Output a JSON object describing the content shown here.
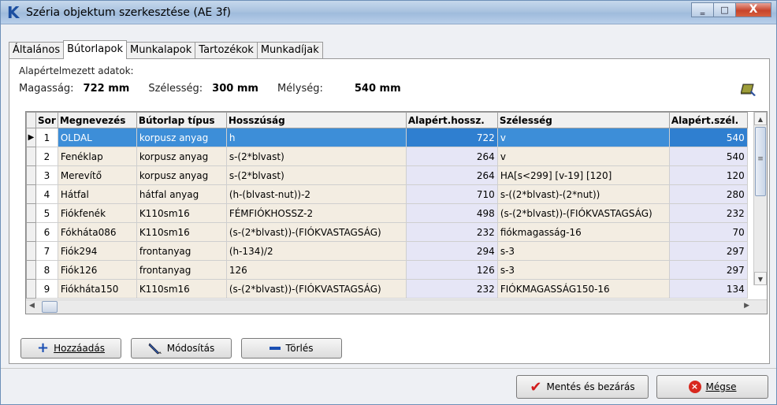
{
  "window": {
    "title": "Széria objektum szerkesztése (AE 3f)",
    "app_icon": "K",
    "controls": {
      "minimize": "‗",
      "maximize": "□",
      "close": "X"
    }
  },
  "tabs": [
    {
      "label": "Általános"
    },
    {
      "label": "Bútorlapok",
      "active": true
    },
    {
      "label": "Munkalapok"
    },
    {
      "label": "Tartozékok"
    },
    {
      "label": "Munkadíjak"
    }
  ],
  "defaults": {
    "group_title": "Alapértelmezett adatok:",
    "height_label": "Magasság:",
    "height_value": "722 mm",
    "width_label": "Szélesség:",
    "width_value": "300 mm",
    "depth_label": "Mélység:",
    "depth_value": "540 mm",
    "icon": "book-edit-icon"
  },
  "grid": {
    "columns": [
      "Sor",
      "Megnevezés",
      "Bútorlap típus",
      "Hosszúság",
      "Alapért.hossz.",
      "Szélesség",
      "Alapért.szél."
    ],
    "rows": [
      {
        "sor": "1",
        "name": "OLDAL",
        "type": "korpusz anyag",
        "length": "h",
        "def_length": "722",
        "width": "v",
        "def_width": "540",
        "selected": true
      },
      {
        "sor": "2",
        "name": "Fenéklap",
        "type": "korpusz anyag",
        "length": "s-(2*blvast)",
        "def_length": "264",
        "width": "v",
        "def_width": "540"
      },
      {
        "sor": "3",
        "name": "Merevítő",
        "type": "korpusz anyag",
        "length": "s-(2*blvast)",
        "def_length": "264",
        "width": "HA[s<299] [v-19] [120]",
        "def_width": "120"
      },
      {
        "sor": "4",
        "name": "Hátfal",
        "type": "hátfal anyag",
        "length": "(h-(blvast-nut))-2",
        "def_length": "710",
        "width": "s-((2*blvast)-(2*nut))",
        "def_width": "280"
      },
      {
        "sor": "5",
        "name": "Fiókfenék",
        "type": "K110sm16",
        "length": "FÉMFIÓKHOSSZ-2",
        "def_length": "498",
        "width": "(s-(2*blvast))-(FIÓKVASTAGSÁG)",
        "def_width": "232"
      },
      {
        "sor": "6",
        "name": "Fókháta086",
        "type": "K110sm16",
        "length": "(s-(2*blvast))-(FIÓKVASTAGSÁG)",
        "def_length": "232",
        "width": "fiókmagasság-16",
        "def_width": "70"
      },
      {
        "sor": "7",
        "name": "Fiók294",
        "type": "frontanyag",
        "length": "(h-134)/2",
        "def_length": "294",
        "width": "s-3",
        "def_width": "297"
      },
      {
        "sor": "8",
        "name": "Fiók126",
        "type": "frontanyag",
        "length": "126",
        "def_length": "126",
        "width": "s-3",
        "def_width": "297"
      },
      {
        "sor": "9",
        "name": "Fiókháta150",
        "type": "K110sm16",
        "length": "(s-(2*blvast))-(FIÓKVASTAGSÁG)",
        "def_length": "232",
        "width": "FIÓKMAGASSÁG150-16",
        "def_width": "134"
      }
    ]
  },
  "buttons": {
    "add": "Hozzáadás",
    "edit": "Módosítás",
    "delete": "Törlés",
    "save_close": "Mentés és bezárás",
    "cancel": "Mégse"
  }
}
